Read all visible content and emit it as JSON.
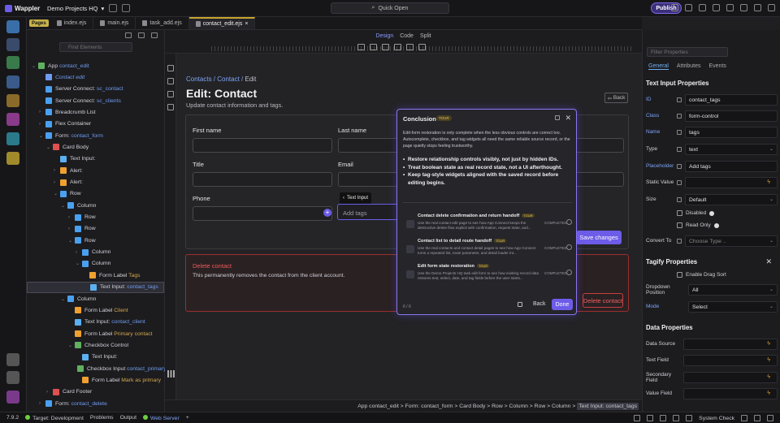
{
  "app": {
    "name": "Wappler",
    "project": "Demo Projects HQ",
    "quick_open": "Quick Open",
    "publish": "Publish"
  },
  "tabs": {
    "pages": "Pages",
    "files": [
      "index.ejs",
      "main.ejs",
      "task_add.ejs",
      "contact_edit.ejs"
    ]
  },
  "sidebar": {
    "search_placeholder": "Find Elements"
  },
  "tree": [
    {
      "d": 0,
      "icon": "#60b060",
      "t": "App ",
      "h": "contact_edit",
      "ch": "v"
    },
    {
      "d": 1,
      "icon": "#6f9cf0",
      "t": "",
      "hi": "Contact edit"
    },
    {
      "d": 1,
      "icon": "#4aa0f0",
      "t": "Server Connect: ",
      "h": "sc_contact"
    },
    {
      "d": 1,
      "icon": "#4aa0f0",
      "t": "Server Connect: ",
      "h": "sc_clients"
    },
    {
      "d": 1,
      "icon": "#4aa0f0",
      "t": "Breadcrumb List",
      "ch": ">"
    },
    {
      "d": 1,
      "icon": "#4aa0f0",
      "t": "Flex Container",
      "ch": ">"
    },
    {
      "d": 1,
      "icon": "#4aa0f0",
      "t": "Form: ",
      "h": "contact_form",
      "ch": "v"
    },
    {
      "d": 2,
      "icon": "#e05050",
      "t": "Card Body",
      "ch": "v"
    },
    {
      "d": 3,
      "icon": "#5ab0f0",
      "t": "Text Input:"
    },
    {
      "d": 3,
      "icon": "#f0a030",
      "t": "Alert:",
      "ch": ">"
    },
    {
      "d": 3,
      "icon": "#f0a030",
      "t": "Alert:",
      "ch": ">"
    },
    {
      "d": 3,
      "icon": "#4aa0f0",
      "t": "Row",
      "ch": "v"
    },
    {
      "d": 4,
      "icon": "#4aa0f0",
      "t": "Column",
      "ch": "v"
    },
    {
      "d": 5,
      "icon": "#4aa0f0",
      "t": "Row",
      "ch": ">"
    },
    {
      "d": 5,
      "icon": "#4aa0f0",
      "t": "Row",
      "ch": ">"
    },
    {
      "d": 5,
      "icon": "#4aa0f0",
      "t": "Row",
      "ch": "v"
    },
    {
      "d": 6,
      "icon": "#4aa0f0",
      "t": "Column",
      "ch": ">"
    },
    {
      "d": 6,
      "icon": "#4aa0f0",
      "t": "Column",
      "ch": "v"
    },
    {
      "d": 7,
      "icon": "#f0a030",
      "t": "Form Label ",
      "y": "Tags"
    },
    {
      "d": 7,
      "icon": "#5ab0f0",
      "t": "Text Input: ",
      "h": "contact_tags",
      "sel": true
    },
    {
      "d": 4,
      "icon": "#4aa0f0",
      "t": "Column",
      "ch": "v"
    },
    {
      "d": 5,
      "icon": "#f0a030",
      "t": "Form Label ",
      "y": "Client"
    },
    {
      "d": 5,
      "icon": "#5ab0f0",
      "t": "Text Input: ",
      "h": "contact_client"
    },
    {
      "d": 5,
      "icon": "#f0a030",
      "t": "Form Label ",
      "y": "Primary contact"
    },
    {
      "d": 5,
      "icon": "#60b060",
      "t": "Checkbox Control",
      "ch": "v"
    },
    {
      "d": 6,
      "icon": "#5ab0f0",
      "t": "Text Input:"
    },
    {
      "d": 6,
      "icon": "#60b060",
      "t": "Checkbox Input ",
      "h": "contact_primary"
    },
    {
      "d": 6,
      "icon": "#f0a030",
      "t": "Form Label ",
      "y": "Mark as primary"
    },
    {
      "d": 2,
      "icon": "#e05050",
      "t": "Card Footer",
      "ch": ">"
    },
    {
      "d": 1,
      "icon": "#4aa0f0",
      "t": "Form: ",
      "h": "contact_delete",
      "ch": ">"
    }
  ],
  "view_modes": [
    "Design",
    "Code",
    "Split"
  ],
  "page": {
    "breadcrumb": [
      "Contacts",
      "Contact",
      "Edit"
    ],
    "title": "Edit: Contact",
    "subtitle": "Update contact information and tags.",
    "back": "Back",
    "labels": {
      "first": "First name",
      "last": "Last name",
      "title": "Title",
      "email": "Email",
      "phone": "Phone"
    },
    "tags_placeholder": "Add tags",
    "tooltip": "Text Input",
    "save": "Save changes",
    "danger_title": "Delete contact",
    "danger_desc": "This permanently removes the contact from the client account.",
    "delete": "Delete contact"
  },
  "modal": {
    "title": "Conclusion",
    "tour": "TOUR",
    "intro": "Edit-form restoration is only complete when the less obvious controls are correct too. Autocomplete, checkbox, and tag widgets all need the same reliable source record, or the page quietly stops feeling trustworthy.",
    "bullets": [
      "Restore relationship controls visibly, not just by hidden IDs.",
      "Treat boolean state as real record state, not a UI afterthought.",
      "Keep tag-style widgets aligned with the saved record before editing begins."
    ],
    "items": [
      {
        "title": "Contact delete confirmation and return handoff",
        "tag": "TOUR",
        "desc": "Use the real contact edit page to see how App Connect keeps the destructive delete flow explicit with confirmation, request state, and...",
        "status": "COMPLETED"
      },
      {
        "title": "Contact list to detail route handoff",
        "tag": "TOUR",
        "desc": "Use the real contacts and contact detail pages to see how App Connect turns a repeated list, route parameter, and detail loader int...",
        "status": "COMPLETED"
      },
      {
        "title": "Edit form state restoration",
        "tag": "TOUR",
        "desc": "Use the Demo Projects HQ task edit form to see how existing record data restores text, select, date, and tag fields before the user starts...",
        "status": "COMPLETED"
      }
    ],
    "step": "6 / 6",
    "back": "Back",
    "done": "Done"
  },
  "crumbpath": [
    "App contact_edit",
    "Form: contact_form",
    "Card Body",
    "Row",
    "Column",
    "Row",
    "Column",
    "Text Input: contact_tags"
  ],
  "props": {
    "filter_placeholder": "Filter Properties",
    "tabs": [
      "General",
      "Attributes",
      "Events"
    ],
    "section1": "Text Input Properties",
    "id_label": "ID",
    "id_val": "contact_tags",
    "class_label": "Class",
    "class_val": "form-control",
    "name_label": "Name",
    "name_val": "tags",
    "type_label": "Type",
    "type_val": "text",
    "ph_label": "Placeholder",
    "ph_val": "Add tags",
    "static_label": "Static Value",
    "size_label": "Size",
    "size_val": "Default",
    "disabled": "Disabled",
    "readonly": "Read Only",
    "convert_label": "Convert To",
    "convert_val": "Choose Type ..",
    "section2": "Tagify Properties",
    "drag": "Enable Drag Sort",
    "dd_pos_label": "Dropdown Position",
    "dd_pos_val": "All",
    "mode_label": "Mode",
    "mode_val": "Select",
    "section3": "Data Properties",
    "ds_label": "Data Source",
    "tf_label": "Text Field",
    "sf_label": "Secondary Field",
    "vf_label": "Value Field"
  },
  "status": {
    "version": "7.9.2",
    "target": "Target: Development",
    "problems": "Problems",
    "output": "Output",
    "server": "Web Server",
    "syscheck": "System Check"
  }
}
